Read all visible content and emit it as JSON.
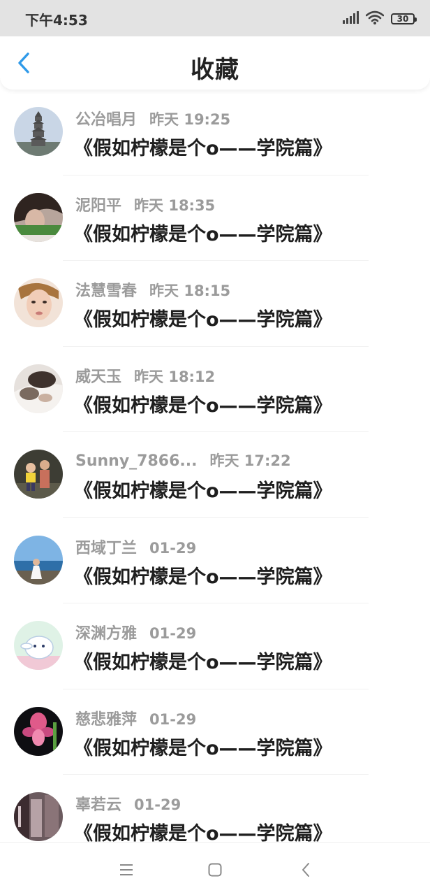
{
  "status_bar": {
    "time": "下午4:53",
    "battery": "30"
  },
  "header": {
    "title": "收藏"
  },
  "icons": {
    "back": "chevron-left-icon",
    "signal": "signal-icon",
    "wifi": "wifi-icon",
    "battery": "battery-icon",
    "menu": "menu-icon",
    "home": "home-square-icon",
    "nav_back": "nav-back-icon"
  },
  "colors": {
    "accent": "#2f9ae9",
    "title_text": "#1e1e1e",
    "meta_text": "#9b9b9b",
    "status_bar_bg": "#e3e3e3"
  },
  "favorites": [
    {
      "name": "公冶唱月",
      "time": "昨天 19:25",
      "title": "《假如柠檬是个o——学院篇》"
    },
    {
      "name": "泥阳平",
      "time": "昨天 18:35",
      "title": "《假如柠檬是个o——学院篇》"
    },
    {
      "name": "法慧雪春",
      "time": "昨天 18:15",
      "title": "《假如柠檬是个o——学院篇》"
    },
    {
      "name": "威天玉",
      "time": "昨天 18:12",
      "title": "《假如柠檬是个o——学院篇》"
    },
    {
      "name": "Sunny_7866...",
      "time": "昨天 17:22",
      "title": "《假如柠檬是个o——学院篇》"
    },
    {
      "name": "西域丁兰",
      "time": "01-29",
      "title": "《假如柠檬是个o——学院篇》"
    },
    {
      "name": "深渊方雅",
      "time": "01-29",
      "title": "《假如柠檬是个o——学院篇》"
    },
    {
      "name": "慈悲雅萍",
      "time": "01-29",
      "title": "《假如柠檬是个o——学院篇》"
    },
    {
      "name": "辜若云",
      "time": "01-29",
      "title": "《假如柠檬是个o——学院篇》"
    }
  ]
}
